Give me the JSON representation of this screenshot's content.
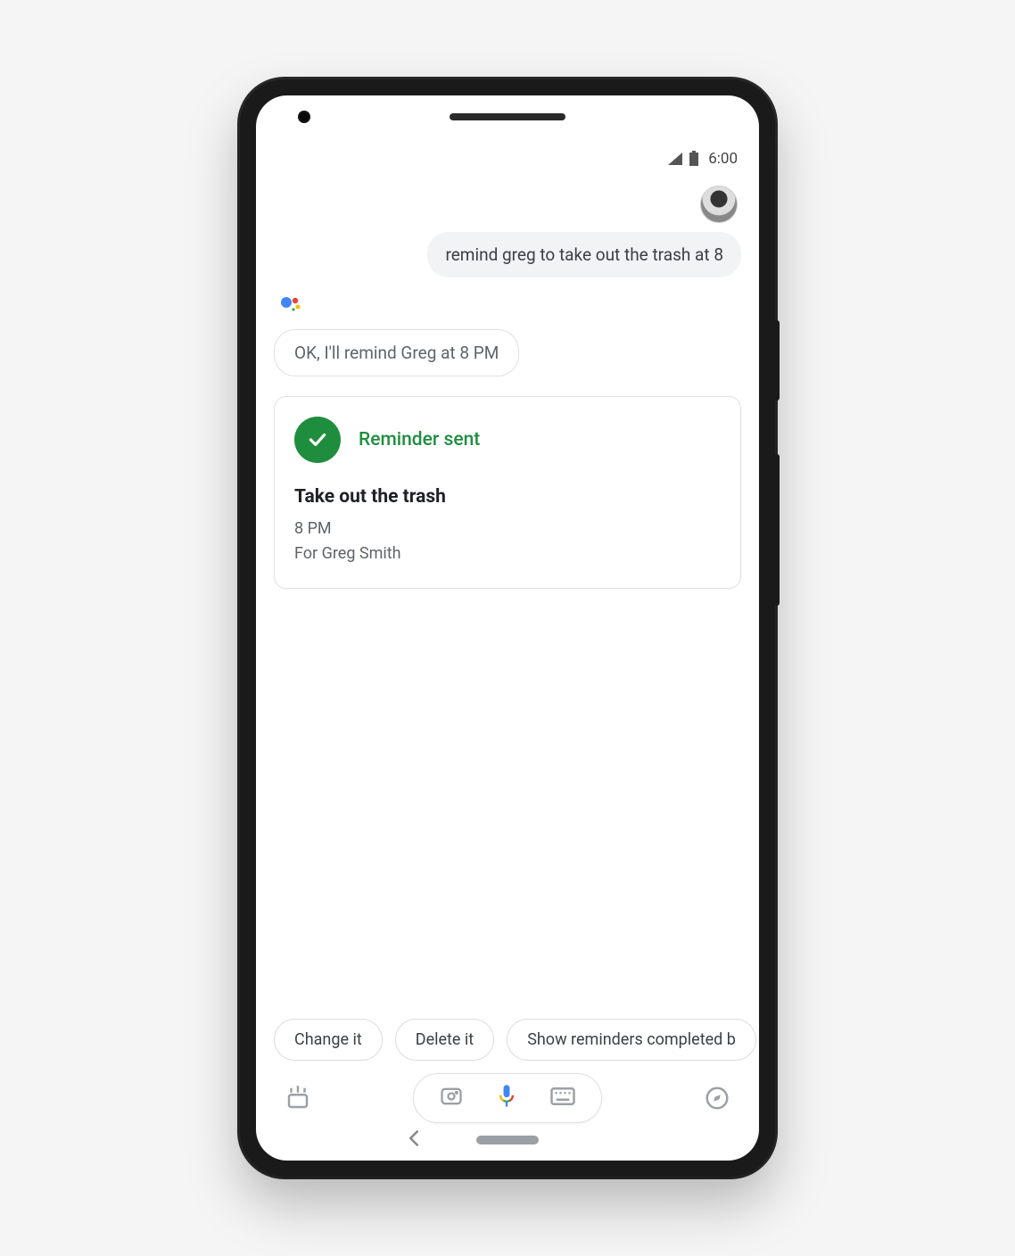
{
  "status_bar": {
    "time": "6:00"
  },
  "user_message": "remind greg to take out the trash at 8",
  "assistant_reply": "OK, I'll remind Greg at 8 PM",
  "card": {
    "status_label": "Reminder sent",
    "title": "Take out the trash",
    "time": "8 PM",
    "for": "For Greg Smith"
  },
  "suggestions": {
    "chip1": "Change it",
    "chip2": "Delete it",
    "chip3": "Show reminders completed b"
  },
  "colors": {
    "green": "#1e8e3e",
    "grey_bubble": "#f1f3f4",
    "text_grey": "#5f6368"
  }
}
